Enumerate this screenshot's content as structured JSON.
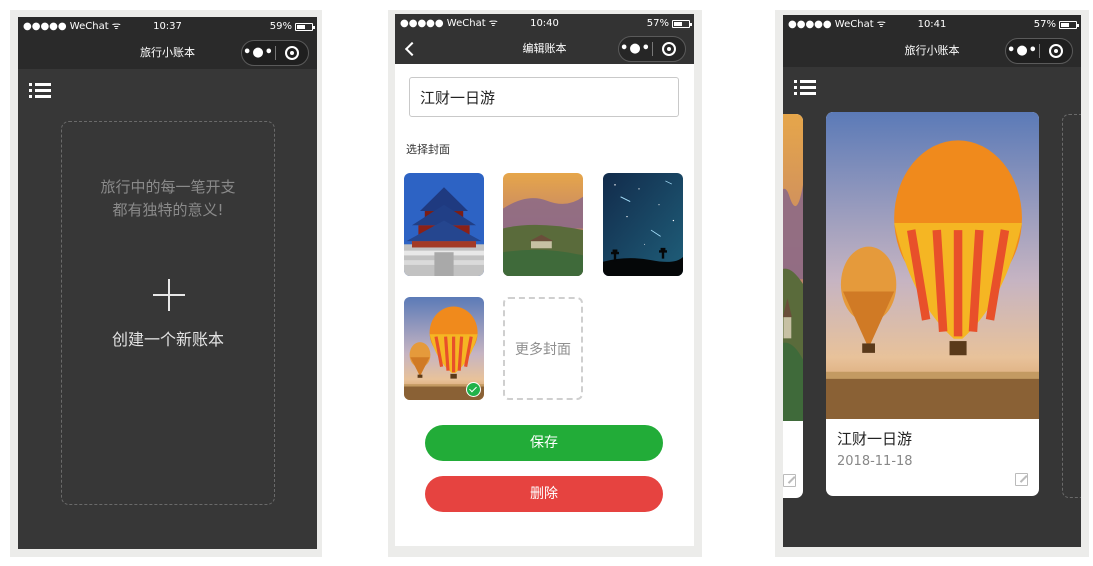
{
  "screens": [
    {
      "status": {
        "carrier": "●●●●● WeChat ᯤ",
        "time": "10:37",
        "battery": "59%",
        "battery_level": 0.59
      },
      "nav": {
        "title": "旅行小账本",
        "menu_dots": "•●•"
      },
      "slogan": [
        "旅行中的每一笔开支",
        "都有独特的意义!"
      ],
      "create_label": "创建一个新账本"
    },
    {
      "status": {
        "carrier": "●●●●● WeChat ᯤ",
        "time": "10:40",
        "battery": "57%",
        "battery_level": 0.57
      },
      "nav": {
        "title": "编辑账本",
        "menu_dots": "•●•"
      },
      "book_name_value": "江财一日游",
      "cover_section_label": "选择封面",
      "more_covers_label": "更多封面",
      "save_label": "保存",
      "delete_label": "删除",
      "colors": {
        "save": "#22ac38",
        "delete": "#e64340"
      }
    },
    {
      "status": {
        "carrier": "●●●●● WeChat ᯤ",
        "time": "10:41",
        "battery": "57%",
        "battery_level": 0.57
      },
      "nav": {
        "title": "旅行小账本",
        "menu_dots": "•●•"
      },
      "book": {
        "name": "江财一日游",
        "date": "2018-11-18"
      }
    }
  ]
}
